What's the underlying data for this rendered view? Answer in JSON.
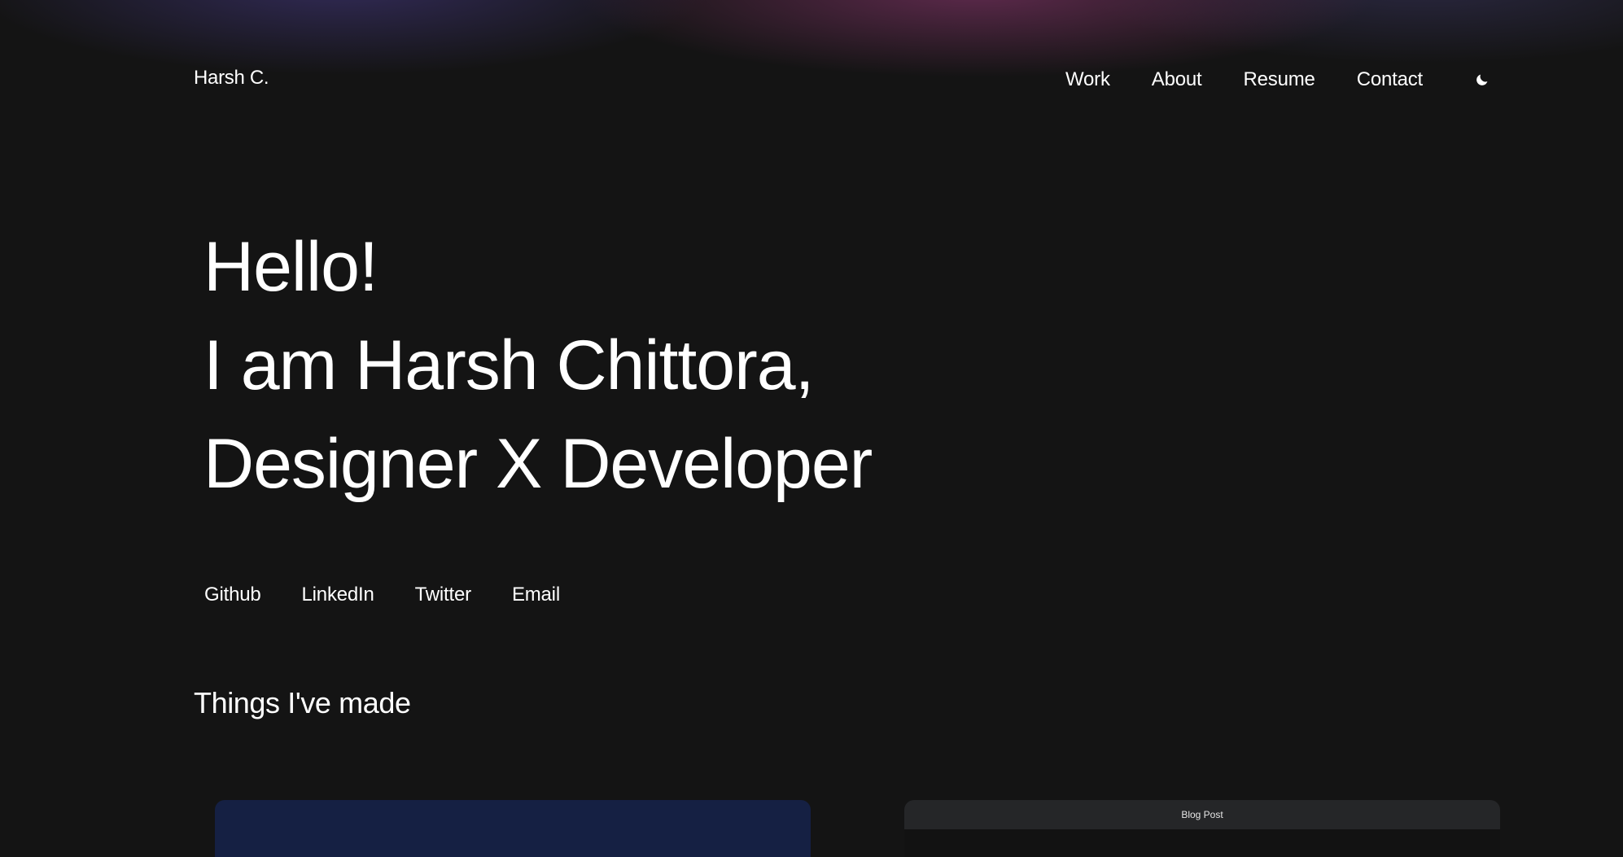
{
  "brand": "Harsh C.",
  "nav": {
    "items": [
      "Work",
      "About",
      "Resume",
      "Contact"
    ],
    "theme_toggle_icon": "moon-icon"
  },
  "hero": {
    "line1": "Hello!",
    "line2": "I am Harsh Chittora,",
    "line3": "Designer X Developer"
  },
  "socials": [
    "Github",
    "LinkedIn",
    "Twitter",
    "Email"
  ],
  "projects": {
    "title": "Things I've made",
    "cards": [
      {
        "label": "",
        "color": "#152043"
      },
      {
        "label": "Blog Post",
        "color": "#252628"
      }
    ]
  },
  "colors": {
    "background": "#141414",
    "text": "#ffffff",
    "glow_purple": "#692d55",
    "glow_indigo": "#3c326e"
  }
}
